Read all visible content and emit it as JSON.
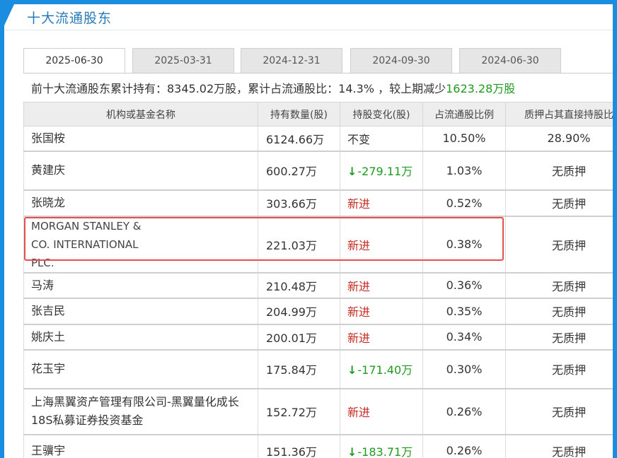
{
  "title": "十大流通股东",
  "tabs": [
    "2025-06-30",
    "2025-03-31",
    "2024-12-31",
    "2024-09-30",
    "2024-06-30"
  ],
  "summary": {
    "prefix": "前十大流通股东累计持有：8345.02万股，累计占流通股比：14.3% ，较上期减少",
    "change": "1623.28万股"
  },
  "table": {
    "headers": [
      "机构或基金名称",
      "持有数量(股)",
      "持股变化(股)",
      "占流通股比例",
      "质押占其直接持股比"
    ],
    "rows": [
      {
        "name": "张国桉",
        "hold": "6124.66万",
        "change": "不变",
        "change_type": "same",
        "pct": "10.50%",
        "pledge": "28.90%"
      },
      {
        "name": "黄建庆",
        "hold": "600.27万",
        "change": "-279.11万",
        "change_type": "down",
        "pct": "1.03%",
        "pledge": "无质押"
      },
      {
        "name": "张晓龙",
        "hold": "303.66万",
        "change": "新进",
        "change_type": "new",
        "pct": "0.52%",
        "pledge": "无质押"
      },
      {
        "name": "MORGAN STANLEY & CO. INTERNATIONAL PLC.",
        "hold": "221.03万",
        "change": "新进",
        "change_type": "new",
        "pct": "0.38%",
        "pledge": "无质押"
      },
      {
        "name": "马涛",
        "hold": "210.48万",
        "change": "新进",
        "change_type": "new",
        "pct": "0.36%",
        "pledge": "无质押"
      },
      {
        "name": "张吉民",
        "hold": "204.99万",
        "change": "新进",
        "change_type": "new",
        "pct": "0.35%",
        "pledge": "无质押"
      },
      {
        "name": "姚庆土",
        "hold": "200.01万",
        "change": "新进",
        "change_type": "new",
        "pct": "0.34%",
        "pledge": "无质押"
      },
      {
        "name": "花玉宇",
        "hold": "175.84万",
        "change": "-171.40万",
        "change_type": "down",
        "pct": "0.30%",
        "pledge": "无质押"
      },
      {
        "name": "上海黑翼资产管理有限公司-黑翼量化成长18S私募证券投资基金",
        "hold": "152.72万",
        "change": "新进",
        "change_type": "new",
        "pct": "0.26%",
        "pledge": "无质押"
      },
      {
        "name": "王骥宇",
        "hold": "151.36万",
        "change": "-183.71万",
        "change_type": "down",
        "pct": "0.26%",
        "pledge": "无质押"
      }
    ]
  },
  "colors": {
    "frame": "#1a8de0",
    "title": "#2a7ab8",
    "new": "#c42a20",
    "down": "#1e9a1e",
    "highlight": "#e35050"
  },
  "icons": {
    "down_change": "down-arrow-icon"
  }
}
